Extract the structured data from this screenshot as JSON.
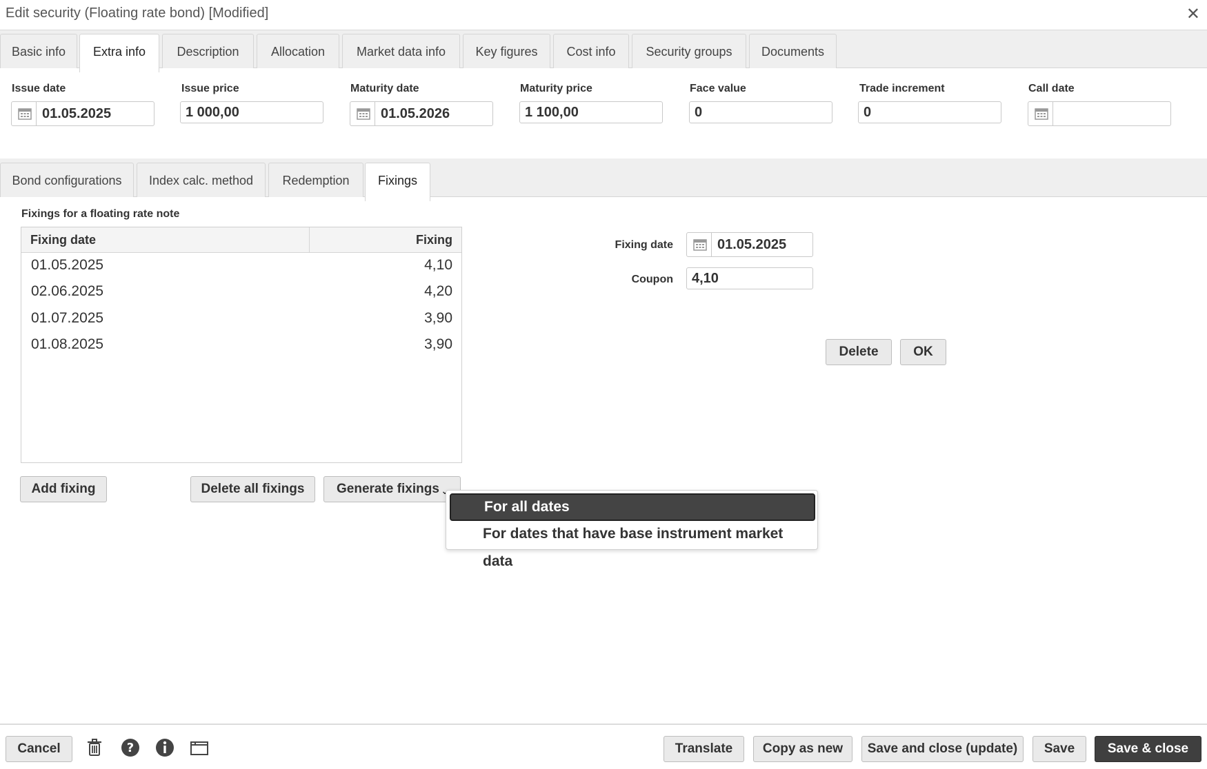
{
  "window": {
    "title": "Edit security (Floating rate bond) [Modified]"
  },
  "top_tabs": [
    "Basic info",
    "Extra info",
    "Description",
    "Allocation",
    "Market data info",
    "Key figures",
    "Cost info",
    "Security groups",
    "Documents"
  ],
  "fields": {
    "issue_date": {
      "label": "Issue date",
      "value": "01.05.2025"
    },
    "issue_price": {
      "label": "Issue price",
      "value": "1 000,00"
    },
    "maturity_date": {
      "label": "Maturity date",
      "value": "01.05.2026"
    },
    "maturity_price": {
      "label": "Maturity price",
      "value": "1 100,00"
    },
    "face_value": {
      "label": "Face value",
      "value": "0"
    },
    "trade_increment": {
      "label": "Trade increment",
      "value": "0"
    },
    "call_date": {
      "label": "Call date",
      "value": ""
    }
  },
  "sub_tabs": [
    "Bond configurations",
    "Index calc. method",
    "Redemption",
    "Fixings"
  ],
  "fixings": {
    "section_title": "Fixings for a floating rate note",
    "columns": [
      "Fixing date",
      "Fixing"
    ],
    "rows": [
      {
        "date": "01.05.2025",
        "value": "4,10"
      },
      {
        "date": "02.06.2025",
        "value": "4,20"
      },
      {
        "date": "01.07.2025",
        "value": "3,90"
      },
      {
        "date": "01.08.2025",
        "value": "3,90"
      }
    ],
    "add_label": "Add fixing",
    "delete_all_label": "Delete all fixings",
    "generate_label": "Generate fixings",
    "menu": [
      "For all dates",
      "For dates that have base instrument market data"
    ]
  },
  "editor": {
    "fixing_date_label": "Fixing date",
    "fixing_date_value": "01.05.2025",
    "coupon_label": "Coupon",
    "coupon_value": "4,10",
    "delete_label": "Delete",
    "ok_label": "OK"
  },
  "footer": {
    "cancel": "Cancel",
    "translate": "Translate",
    "copy_as_new": "Copy as new",
    "save_close_update": "Save and close (update)",
    "save": "Save",
    "save_close": "Save & close"
  },
  "colors": {
    "accent_dark": "#3f3f3f",
    "tab_bg": "#efefef",
    "border": "#d5d5d5"
  }
}
